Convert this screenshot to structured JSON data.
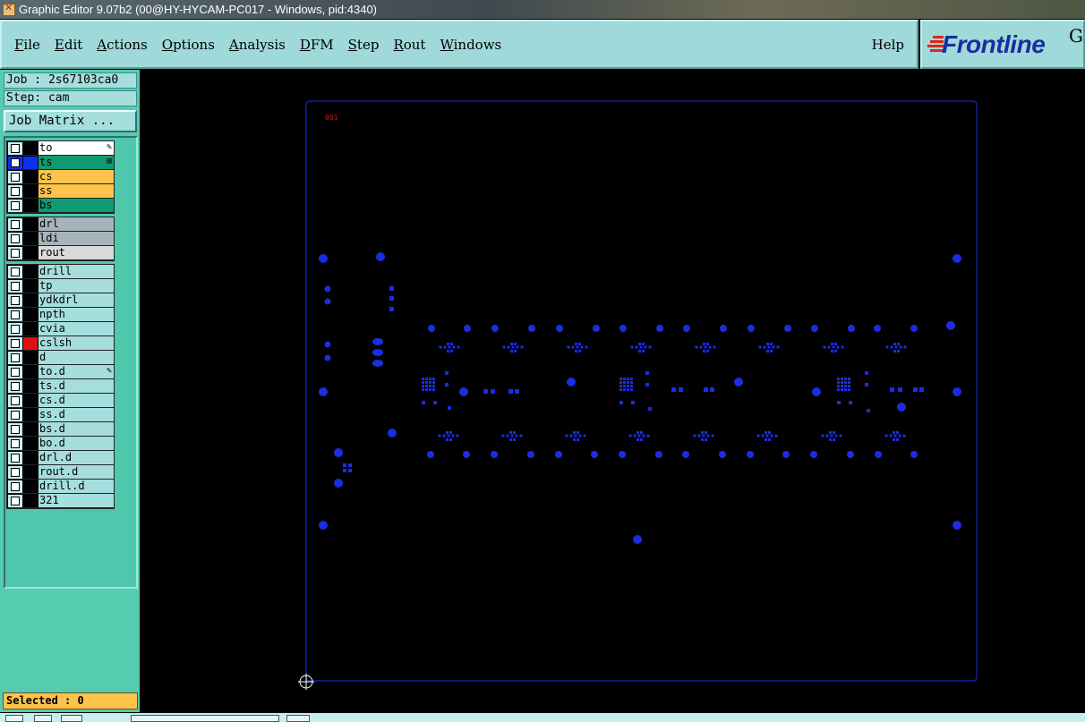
{
  "window": {
    "title": "Graphic Editor 9.07b2 (00@HY-HYCAM-PC017 - Windows, pid:4340)"
  },
  "menu": {
    "items": [
      {
        "first": "F",
        "rest": "ile"
      },
      {
        "first": "E",
        "rest": "dit"
      },
      {
        "first": "A",
        "rest": "ctions"
      },
      {
        "first": "O",
        "rest": "ptions"
      },
      {
        "first": "A",
        "rest": "nalysis"
      },
      {
        "first": "D",
        "rest": "FM"
      },
      {
        "first": "S",
        "rest": "tep"
      },
      {
        "first": "R",
        "rest": "out"
      },
      {
        "first": "W",
        "rest": "indows"
      }
    ],
    "help": "Help"
  },
  "brand": {
    "logo": "Frontline",
    "extra": "G"
  },
  "info": {
    "job": "Job : 2s67103ca0",
    "step": "Step: cam",
    "job_matrix": "Job Matrix ..."
  },
  "layers": {
    "groups": [
      [
        {
          "name": "to",
          "bg": "#ffffff",
          "swatch": "#000000",
          "mark": "pen"
        },
        {
          "name": "ts",
          "bg": "#0f9a72",
          "swatch": "#1030f0",
          "mark": "grid",
          "active": true
        },
        {
          "name": "cs",
          "bg": "#ffc34d",
          "swatch": "#000000"
        },
        {
          "name": "ss",
          "bg": "#ffc34d",
          "swatch": "#000000"
        },
        {
          "name": "bs",
          "bg": "#0f9a72",
          "swatch": "#000000"
        }
      ],
      [
        {
          "name": "drl",
          "bg": "#a7b3bb",
          "swatch": "#000000"
        },
        {
          "name": "ldi",
          "bg": "#a7b3bb",
          "swatch": "#000000"
        },
        {
          "name": "rout",
          "bg": "#d9d9d9",
          "swatch": "#000000"
        }
      ],
      [
        {
          "name": "drill",
          "bg": "#a6dede",
          "swatch": "#000000"
        },
        {
          "name": "tp",
          "bg": "#a6dede",
          "swatch": "#000000"
        },
        {
          "name": "ydkdrl",
          "bg": "#a6dede",
          "swatch": "#000000"
        },
        {
          "name": "npth",
          "bg": "#a6dede",
          "swatch": "#000000"
        },
        {
          "name": "cvia",
          "bg": "#a6dede",
          "swatch": "#000000"
        },
        {
          "name": "cslsh",
          "bg": "#a6dede",
          "swatch": "#e01010"
        },
        {
          "name": "d",
          "bg": "#a6dede",
          "swatch": "#000000"
        },
        {
          "name": "to.d",
          "bg": "#a6dede",
          "swatch": "#000000",
          "mark": "pen"
        },
        {
          "name": "ts.d",
          "bg": "#a6dede",
          "swatch": "#000000"
        },
        {
          "name": "cs.d",
          "bg": "#a6dede",
          "swatch": "#000000"
        },
        {
          "name": "ss.d",
          "bg": "#a6dede",
          "swatch": "#000000"
        },
        {
          "name": "bs.d",
          "bg": "#a6dede",
          "swatch": "#000000"
        },
        {
          "name": "bo.d",
          "bg": "#a6dede",
          "swatch": "#000000"
        },
        {
          "name": "drl.d",
          "bg": "#a6dede",
          "swatch": "#000000"
        },
        {
          "name": "rout.d",
          "bg": "#a6dede",
          "swatch": "#000000"
        },
        {
          "name": "drill.d",
          "bg": "#a6dede",
          "swatch": "#000000"
        },
        {
          "name": "321",
          "bg": "#a6dede",
          "swatch": "#000000"
        }
      ]
    ]
  },
  "status": {
    "selected": "Selected : 0"
  },
  "board": {
    "label": "001",
    "outline_color": "#1a2de0",
    "feature_color": "#1a2de0",
    "label_color": "#e01010"
  }
}
